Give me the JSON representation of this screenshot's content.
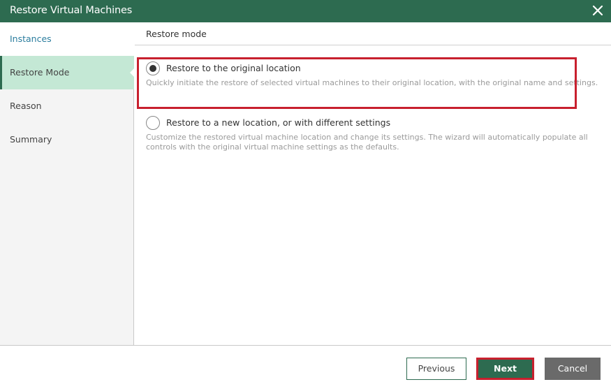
{
  "window": {
    "title": "Restore Virtual Machines",
    "close_icon": "close-icon"
  },
  "sidebar": {
    "items": [
      {
        "label": "Instances",
        "state": "completed"
      },
      {
        "label": "Restore Mode",
        "state": "active"
      },
      {
        "label": "Reason",
        "state": "pending"
      },
      {
        "label": "Summary",
        "state": "pending"
      }
    ]
  },
  "main": {
    "section_title": "Restore mode",
    "options": [
      {
        "label": "Restore to the original location",
        "description": "Quickly initiate the restore of selected virtual machines to their original location, with the original name and settings.",
        "selected": true,
        "highlighted": true
      },
      {
        "label": "Restore to a new location, or with different settings",
        "description": "Customize the restored virtual machine location and change its settings. The wizard will automatically populate all controls with the original virtual machine settings as the defaults.",
        "selected": false,
        "highlighted": false
      }
    ]
  },
  "footer": {
    "previous_label": "Previous",
    "next_label": "Next",
    "cancel_label": "Cancel"
  },
  "colors": {
    "brand": "#2d6b50",
    "active_step": "#c4e8d5",
    "highlight_border": "#c8202e",
    "completed_step_text": "#2b7d9e"
  }
}
